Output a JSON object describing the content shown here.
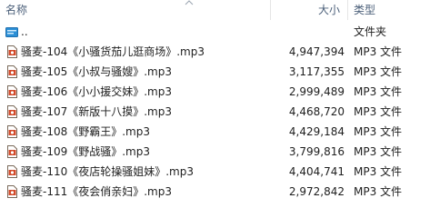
{
  "columns": {
    "name": "名称",
    "size": "大小",
    "type": "类型"
  },
  "parent_row": {
    "name": "..",
    "type": "文件夹",
    "icon": "up-folder-icon"
  },
  "files": [
    {
      "name": "骚麦-104《小骚货茄儿逛商场》.mp3",
      "size": "4,947,394",
      "type": "MP3 文件",
      "icon": "mp3-file-icon"
    },
    {
      "name": "骚麦-105《小叔与骚嫂》.mp3",
      "size": "3,117,355",
      "type": "MP3 文件",
      "icon": "mp3-file-icon"
    },
    {
      "name": "骚麦-106《小小援交妹》.mp3",
      "size": "2,999,489",
      "type": "MP3 文件",
      "icon": "mp3-file-icon"
    },
    {
      "name": "骚麦-107《新版十八摸》.mp3",
      "size": "4,468,720",
      "type": "MP3 文件",
      "icon": "mp3-file-icon"
    },
    {
      "name": "骚麦-108《野霸王》.mp3",
      "size": "4,429,184",
      "type": "MP3 文件",
      "icon": "mp3-file-icon"
    },
    {
      "name": "骚麦-109《野战骚》.mp3",
      "size": "3,799,816",
      "type": "MP3 文件",
      "icon": "mp3-file-icon"
    },
    {
      "name": "骚麦-110《夜店轮操骚姐妹》.mp3",
      "size": "4,404,741",
      "type": "MP3 文件",
      "icon": "mp3-file-icon"
    },
    {
      "name": "骚麦-111《夜会俏亲妇》.mp3",
      "size": "2,972,842",
      "type": "MP3 文件",
      "icon": "mp3-file-icon"
    }
  ]
}
